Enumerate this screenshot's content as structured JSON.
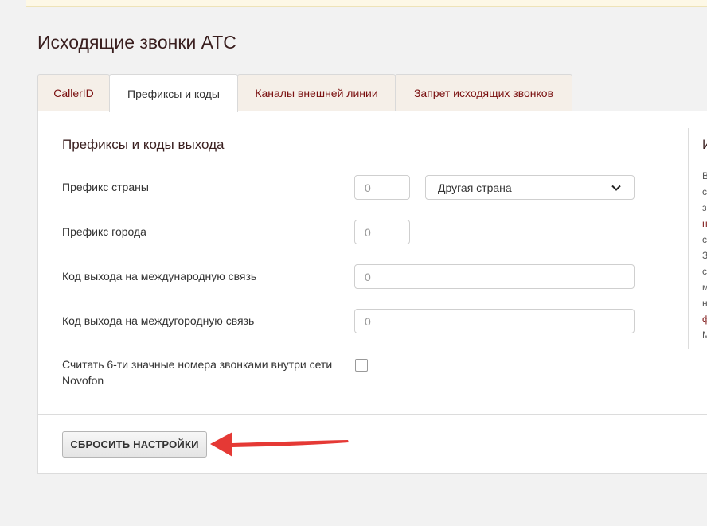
{
  "page": {
    "title": "Исходящие звонки АТС"
  },
  "tabs": [
    {
      "label": "CallerID"
    },
    {
      "label": "Префиксы и коды"
    },
    {
      "label": "Каналы внешней линии"
    },
    {
      "label": "Запрет исходящих звонков"
    }
  ],
  "form": {
    "section_title": "Префиксы и коды выхода",
    "country_prefix": {
      "label": "Префикс страны",
      "value": "0"
    },
    "country_select": {
      "value": "Другая страна"
    },
    "city_prefix": {
      "label": "Префикс города",
      "value": "0"
    },
    "intl_code": {
      "label": "Код выхода на международную связь",
      "value": "0"
    },
    "long_code": {
      "label": "Код выхода на междугородную связь",
      "value": "0"
    },
    "six_digit": {
      "label_line1": "Считать 6-ти значные номера звонками внутри сети",
      "label_line2": "Novofon",
      "checked": false
    },
    "reset_button": "СБРОСИТЬ НАСТРОЙКИ"
  },
  "sidebar": {
    "title_fragment": "И",
    "fragments": [
      "В",
      "с",
      "з",
      "н",
      "с",
      "З",
      "с",
      "м",
      "н",
      "ф",
      "М"
    ]
  },
  "colors": {
    "accent": "#7a1010",
    "annotation_arrow": "#e53935"
  }
}
